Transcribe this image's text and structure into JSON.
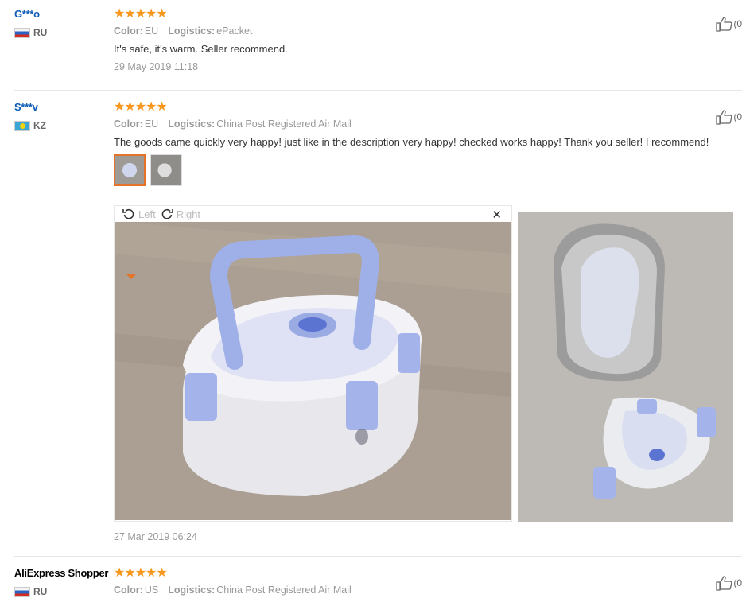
{
  "reviews": [
    {
      "user": "G***o",
      "country": "RU",
      "stars": "★★★★★",
      "color_label": "Color:",
      "color_value": "EU",
      "logistics_label": "Logistics:",
      "logistics_value": "ePacket",
      "text": "It's safe, it's warm. Seller recommend.",
      "date": "29 May 2019 11:18",
      "likes": "(0"
    },
    {
      "user": "S***v",
      "country": "KZ",
      "stars": "★★★★★",
      "color_label": "Color:",
      "color_value": "EU",
      "logistics_label": "Logistics:",
      "logistics_value": "China Post Registered Air Mail",
      "text": "The goods came quickly very happy! just like in the description very happy! checked works happy! Thank you seller! I recommend!",
      "date": "27 Mar 2019 06:24",
      "likes": "(0"
    },
    {
      "user": "AliExpress Shopper",
      "country": "RU",
      "stars": "★★★★★",
      "color_label": "Color:",
      "color_value": "US",
      "logistics_label": "Logistics:",
      "logistics_value": "China Post Registered Air Mail",
      "likes": "(0"
    }
  ],
  "viewer": {
    "rotate_left": "Left",
    "rotate_right": "Right",
    "close": "✕"
  },
  "icons": {
    "thumbs_up": "thumbs-up-icon",
    "rotate_left": "rotate-left-icon",
    "rotate_right": "rotate-right-icon",
    "close": "close-icon"
  },
  "colors": {
    "link": "#0b5bb5",
    "star": "#f7971d",
    "active_thumb": "#e3742a"
  }
}
